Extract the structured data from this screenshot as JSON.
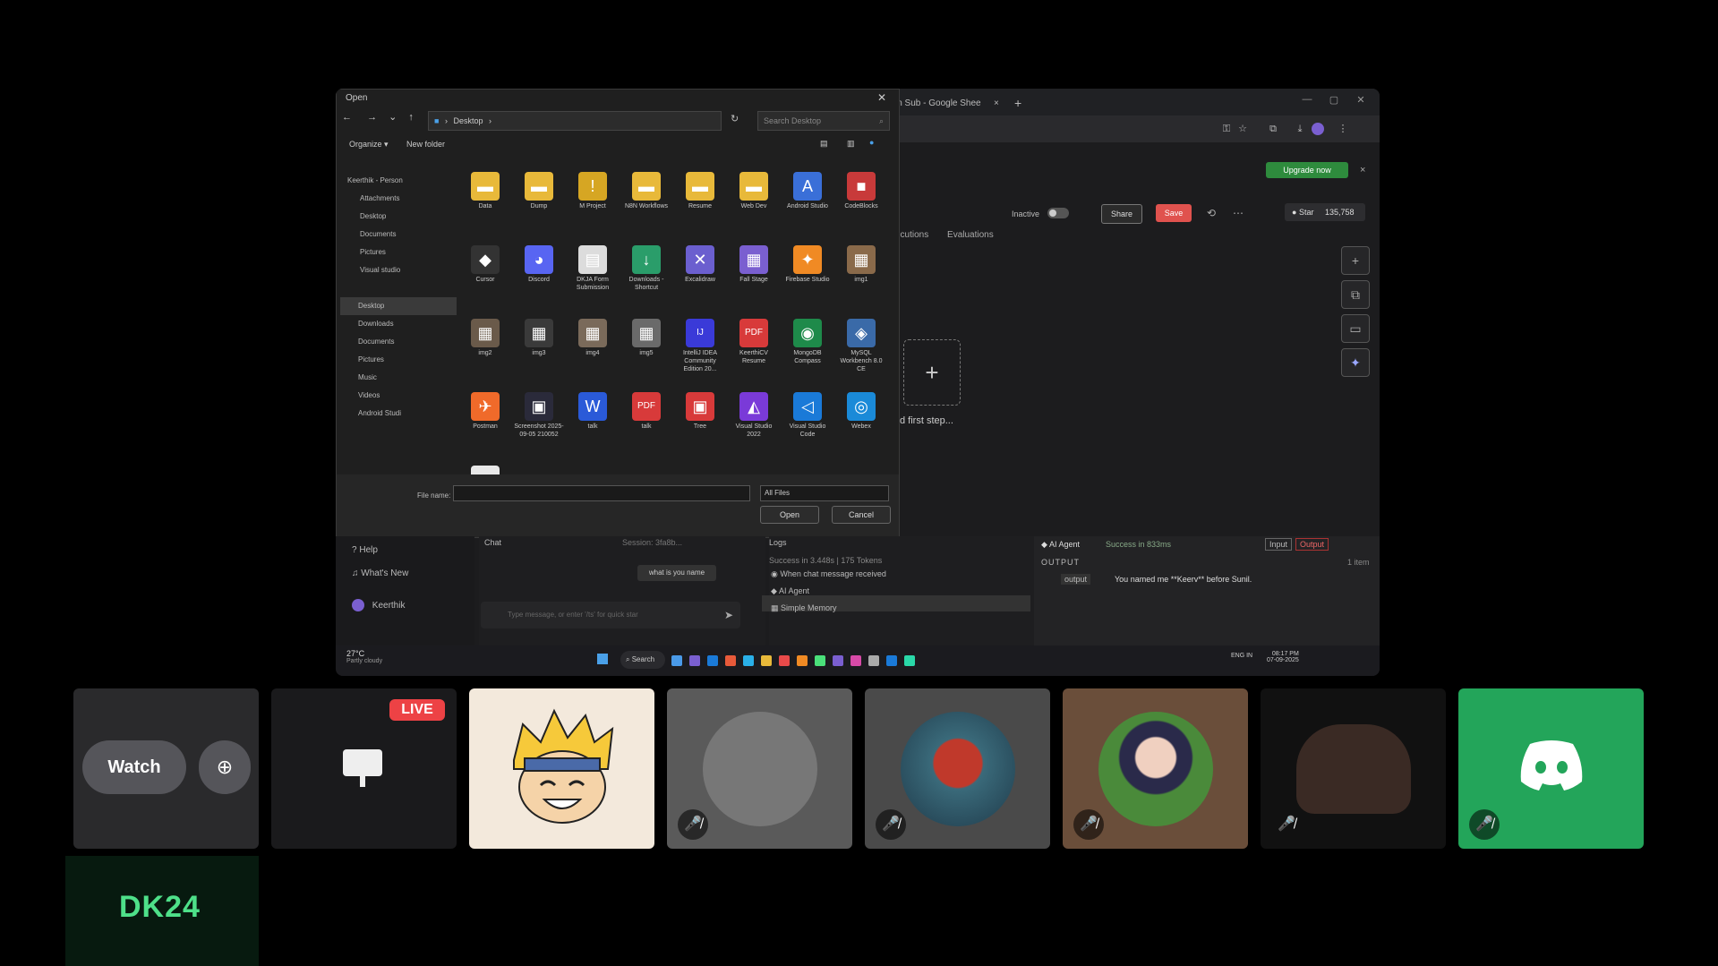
{
  "screen": {
    "browser": {
      "tab_sheet": "in Sub - Google Shee",
      "tab_plus": "+",
      "upgrade_label": "Upgrade now",
      "upgrade_close": "×"
    },
    "editor": {
      "inactive_label": "Inactive",
      "share_label": "Share",
      "save_label": "Save",
      "star_label": "Star",
      "star_count": "135,758",
      "tabs": [
        "ecutions",
        "Evaluations"
      ],
      "first_step_label": "d first step..."
    },
    "dialog": {
      "title": "Open",
      "path": "Desktop",
      "search_placeholder": "Search Desktop",
      "organize_label": "Organize ▾",
      "new_folder_label": "New folder",
      "sidebar": [
        "Keerthik - Person",
        "Attachments",
        "Desktop",
        "Documents",
        "Pictures",
        "Visual studio",
        "Desktop",
        "Downloads",
        "Documents",
        "Pictures",
        "Music",
        "Videos",
        "Android Studi"
      ],
      "files": [
        {
          "label": "Data",
          "color": "#e8b93a",
          "glyph": "▬"
        },
        {
          "label": "Dump",
          "color": "#e8b93a",
          "glyph": "▬"
        },
        {
          "label": "M Project",
          "color": "#d6a623",
          "glyph": "!"
        },
        {
          "label": "N8N Workflows",
          "color": "#e8b93a",
          "glyph": "▬"
        },
        {
          "label": "Resume",
          "color": "#e8b93a",
          "glyph": "▬"
        },
        {
          "label": "Web Dev",
          "color": "#e8b93a",
          "glyph": "▬"
        },
        {
          "label": "Android Studio",
          "color": "#3a6fd8",
          "glyph": "A"
        },
        {
          "label": "CodeBlocks",
          "color": "#c83a3a",
          "glyph": "■"
        },
        {
          "label": "Cursor",
          "color": "#333333",
          "glyph": "◆"
        },
        {
          "label": "Discord",
          "color": "#5865f2",
          "glyph": "◕"
        },
        {
          "label": "DKJA Form Submission",
          "color": "#dcdcdc",
          "glyph": "▤"
        },
        {
          "label": "Downloads - Shortcut",
          "color": "#2a9d6a",
          "glyph": "↓"
        },
        {
          "label": "Excalidraw",
          "color": "#6b5fcf",
          "glyph": "✕"
        },
        {
          "label": "Fall Stage",
          "color": "#7a5fd0",
          "glyph": "▦"
        },
        {
          "label": "Firebase Studio",
          "color": "#f08a24",
          "glyph": "✦"
        },
        {
          "label": "img1",
          "color": "#8a6a4a",
          "glyph": "▦"
        },
        {
          "label": "img2",
          "color": "#6a5a4a",
          "glyph": "▦"
        },
        {
          "label": "img3",
          "color": "#3a3a3a",
          "glyph": "▦"
        },
        {
          "label": "img4",
          "color": "#7a6a5a",
          "glyph": "▦"
        },
        {
          "label": "img5",
          "color": "#6a6a6a",
          "glyph": "▦"
        },
        {
          "label": "IntelliJ IDEA Community Edition 20...",
          "color": "#3a3ad8",
          "glyph": "IJ"
        },
        {
          "label": "KeerthiCV Resume",
          "color": "#d83a3a",
          "glyph": "PDF"
        },
        {
          "label": "MongoDB Compass",
          "color": "#1e8a4a",
          "glyph": "◉"
        },
        {
          "label": "MySQL Workbench 8.0 CE",
          "color": "#3a6aa8",
          "glyph": "◈"
        },
        {
          "label": "Postman",
          "color": "#f06a2a",
          "glyph": "✈"
        },
        {
          "label": "Screenshot 2025-09-05 210052",
          "color": "#2a2a3a",
          "glyph": "▣"
        },
        {
          "label": "talk",
          "color": "#2a5ad8",
          "glyph": "W"
        },
        {
          "label": "talk",
          "color": "#d83a3a",
          "glyph": "PDF"
        },
        {
          "label": "Tree",
          "color": "#d83a3a",
          "glyph": "▣"
        },
        {
          "label": "Visual Studio 2022",
          "color": "#7a3ad8",
          "glyph": "◭"
        },
        {
          "label": "Visual Studio Code",
          "color": "#1a7ad8",
          "glyph": "◁"
        },
        {
          "label": "Webex",
          "color": "#1a8ad8",
          "glyph": "◎"
        },
        {
          "label": "",
          "color": "#e8e8e8",
          "glyph": "▯"
        }
      ],
      "file_name_label": "File name:",
      "file_type": "All Files",
      "open_label": "Open",
      "cancel_label": "Cancel"
    },
    "menu": {
      "help": "Help",
      "whats_new": "What's New",
      "user": "Keerthik"
    },
    "chat": {
      "title": "Chat",
      "session": "Session: 3fa8b...",
      "bubble": "what is you name",
      "input_placeholder": "Type message, or enter '/ts' for quick star"
    },
    "logs": {
      "title": "Logs",
      "summary": "Success in 3.448s | 175 Tokens",
      "items": [
        "When chat message received",
        "AI Agent",
        "Simple Memory"
      ]
    },
    "output": {
      "agent": "AI Agent",
      "status": "Success in 833ms",
      "input_tab": "Input",
      "output_tab": "Output",
      "section": "OUTPUT",
      "count": "1 item",
      "key": "output",
      "text": "You named me **Keerv** before Sunil."
    },
    "taskbar": {
      "weather_temp": "27°C",
      "weather_desc": "Partly cloudy",
      "search": "Search",
      "lang": "ENG\nIN",
      "time": "08:17 PM",
      "date": "07-09-2025"
    }
  },
  "participants": {
    "watch_label": "Watch",
    "live_badge": "LIVE",
    "server_name": "DK24"
  },
  "colors": {
    "discord_green": "#23a55a",
    "live_red": "#ed4245",
    "dk24_green": "#4ee089"
  }
}
